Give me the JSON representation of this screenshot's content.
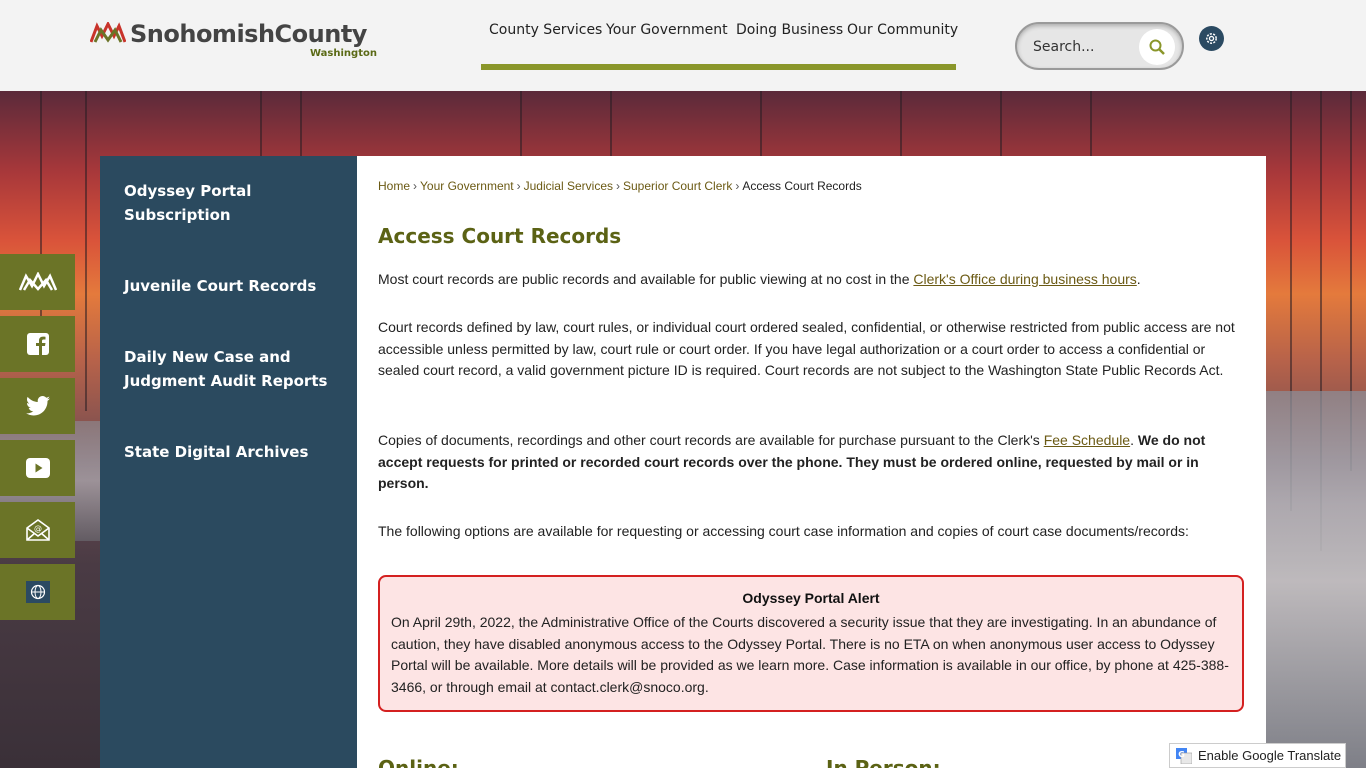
{
  "header": {
    "logo_name": "SnohomishCounty",
    "logo_sub": "Washington",
    "nav": [
      {
        "label": "County Services"
      },
      {
        "label": "Your Government"
      },
      {
        "label": "Doing Business"
      },
      {
        "label": "Our Community"
      }
    ],
    "search_placeholder": "Search..."
  },
  "social": [
    {
      "icon": "county-logo-icon"
    },
    {
      "icon": "facebook-icon"
    },
    {
      "icon": "twitter-icon"
    },
    {
      "icon": "youtube-icon"
    },
    {
      "icon": "email-icon"
    },
    {
      "icon": "globe-icon"
    }
  ],
  "sidebar": {
    "items": [
      {
        "label": "Odyssey Portal Subscription"
      },
      {
        "label": "Juvenile Court Records"
      },
      {
        "label": "Daily New Case and Judgment Audit Reports"
      },
      {
        "label": "State Digital Archives"
      }
    ]
  },
  "breadcrumb": {
    "home": "Home",
    "gov": "Your Government",
    "judicial": "Judicial Services",
    "clerk": "Superior Court Clerk",
    "current": "Access Court Records",
    "separator": "›"
  },
  "main": {
    "title": "Access Court Records",
    "p1_text": "Most court records are public records and available for public viewing at no cost in the ",
    "p1_link": "Clerk's Office during business hours",
    "p1_end": ".",
    "p2": "Court records defined by law, court rules, or individual court ordered sealed, confidential, or otherwise restricted from public access are not accessible unless permitted by law, court rule or court order.  If you have legal authorization or a court order to access a confidential or sealed court record, a valid government picture ID is required.  Court records are not subject to the Washington State Public Records Act.",
    "p3_text": "Copies of documents, recordings and other court records are available for purchase pursuant to the Clerk's ",
    "p3_link": "Fee Schedule",
    "p3_mid": ".  ",
    "p3_bold": "We do not accept requests for printed or recorded court records over the phone. They must be ordered online, requested by mail or in person.",
    "p4": "The following options are available for requesting or accessing court case information and copies of court case documents/records:",
    "alert_title": "Odyssey Portal Alert",
    "alert_body": "On April 29th, 2022, the Administrative Office of the Courts discovered a security issue that they are investigating. In an abundance of caution, they have disabled anonymous access to the Odyssey Portal. There is no ETA on when anonymous user access to Odyssey Portal will be available. More details will be provided as we learn more. Case information is available in our office, by phone at 425-388-3466, or through email at contact.clerk@snoco.org.",
    "online_heading": "Online:",
    "inperson_heading": "In Person:"
  },
  "translate": {
    "label": "Enable Google Translate"
  },
  "colors": {
    "accent": "#8a962a",
    "sidebar": "#2b4a5f",
    "title": "#5b6214",
    "alert_border": "#d42020"
  }
}
